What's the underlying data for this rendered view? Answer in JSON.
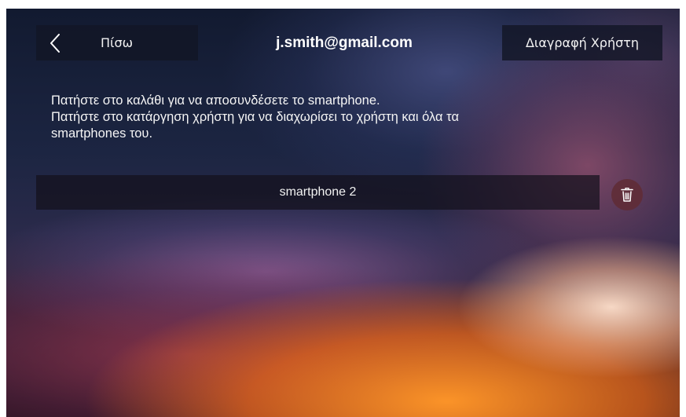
{
  "header": {
    "back_label": "Πίσω",
    "title": "j.smith@gmail.com",
    "delete_user_label": "Διαγραφή Χρήστη"
  },
  "instructions": {
    "line1": "Πατήστε στο καλάθι για να αποσυνδέσετε το smartphone.",
    "line2": "Πατήστε στο κατάργηση χρήστη για να διαχωρίσει το χρήστη και όλα τα",
    "line3": "smartphones του."
  },
  "devices": [
    {
      "name": "smartphone 2",
      "action_icon": "trash-icon"
    }
  ],
  "icons": {
    "back": "chevron-left-icon",
    "delete": "trash-icon"
  },
  "colors": {
    "text": "#ffffff",
    "tile_background": "#121626",
    "trash_button": "#5f2d37",
    "accent_glow": "#ff9628"
  }
}
